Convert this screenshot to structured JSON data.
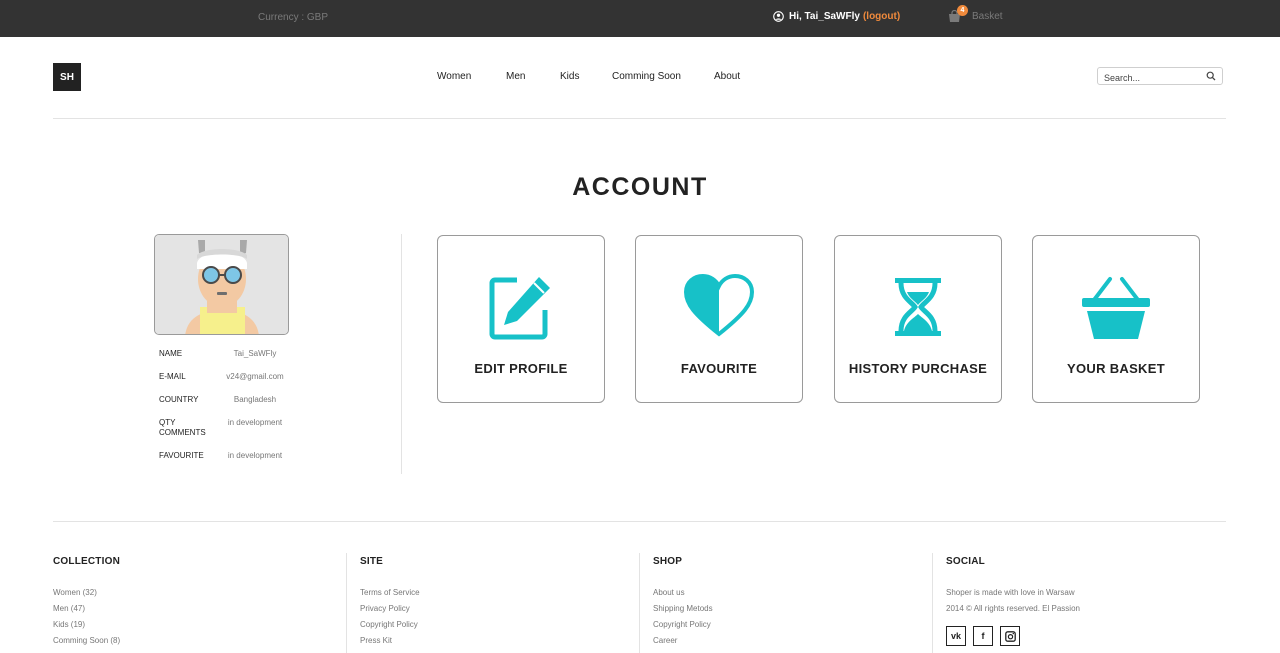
{
  "topbar": {
    "currency": "Currency : GBP",
    "greeting": "Hi, Tai_SaWFly",
    "logout_open": "(",
    "logout": "logout",
    "logout_close": ")",
    "basket_label": "Basket",
    "basket_count": "4"
  },
  "header": {
    "logo": "SH",
    "nav": [
      "Women",
      "Men",
      "Kids",
      "Comming Soon",
      "About"
    ],
    "search_placeholder": "Search..."
  },
  "page": {
    "title": "ACCOUNT"
  },
  "profile": {
    "fields": [
      {
        "label": "NAME",
        "value": "Tai_SaWFly"
      },
      {
        "label": "E-MAIL",
        "value": "v24@gmail.com"
      },
      {
        "label": "COUNTRY",
        "value": "Bangladesh"
      },
      {
        "label": "QTY COMMENTS",
        "value": "in development"
      },
      {
        "label": "FAVOURITE",
        "value": "in development"
      }
    ]
  },
  "cards": [
    {
      "label": "EDIT PROFILE",
      "icon": "edit-icon"
    },
    {
      "label": "FAVOURITE",
      "icon": "heart-icon"
    },
    {
      "label": "HISTORY PURCHASE",
      "icon": "hourglass-icon"
    },
    {
      "label": "YOUR BASKET",
      "icon": "basket-icon"
    }
  ],
  "footer": {
    "collection": {
      "title": "COLLECTION",
      "links": [
        "Women (32)",
        "Men (47)",
        "Kids (19)",
        "Comming Soon (8)"
      ]
    },
    "site": {
      "title": "SITE",
      "links": [
        "Terms of Service",
        "Privacy Policy",
        "Copyright Policy",
        "Press Kit"
      ]
    },
    "shop": {
      "title": "SHOP",
      "links": [
        "About us",
        "Shipping Metods",
        "Copyright Policy",
        "Career"
      ]
    },
    "social": {
      "title": "SOCIAL",
      "lines": [
        "Shoper is made with love in Warsaw",
        "2014 © All rights reserved. El Passion"
      ],
      "icons": [
        "vk",
        "f"
      ]
    }
  },
  "colors": {
    "accent": "#17c1c8",
    "topbar": "#333333",
    "logout": "#f08a3c"
  }
}
